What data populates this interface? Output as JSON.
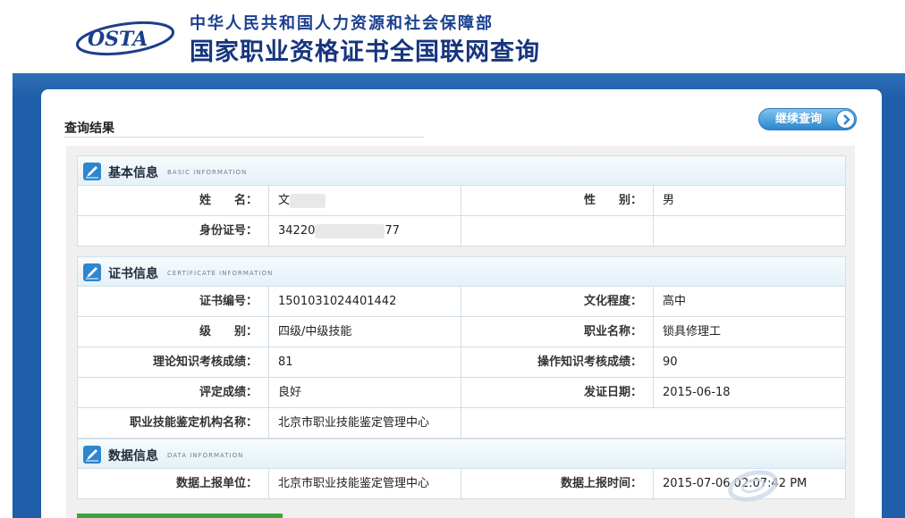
{
  "header": {
    "logo_text": "OSTA",
    "ministry": "中华人民共和国人力资源和社会保障部",
    "site_title": "国家职业资格证书全国联网查询"
  },
  "results": {
    "title": "查询结果",
    "continue_button": "继续查询"
  },
  "basic": {
    "title": "基本信息",
    "subtitle": "BASIC INFORMATION",
    "name_label": "姓　　名：",
    "name_value": "文",
    "gender_label": "性　　别：",
    "gender_value": "男",
    "id_label": "身份证号：",
    "id_prefix": "34220",
    "id_suffix": "77"
  },
  "certificate": {
    "title": "证书信息",
    "subtitle": "CERTIFICATE INFORMATION",
    "number_label": "证书编号：",
    "number_value": "1501031024401442",
    "education_label": "文化程度：",
    "education_value": "高中",
    "level_label": "级　　别：",
    "level_value": "四级/中级技能",
    "occupation_label": "职业名称：",
    "occupation_value": "锁具修理工",
    "theory_label": "理论知识考核成绩：",
    "theory_value": "81",
    "operation_label": "操作知识考核成绩：",
    "operation_value": "90",
    "rating_label": "评定成绩：",
    "rating_value": "良好",
    "issue_date_label": "发证日期：",
    "issue_date_value": "2015-06-18",
    "agency_label": "职业技能鉴定机构名称：",
    "agency_value": "北京市职业技能鉴定管理中心"
  },
  "data_info": {
    "title": "数据信息",
    "subtitle": "DATA INFORMATION",
    "reporter_label": "数据上报单位：",
    "reporter_value": "北京市职业技能鉴定管理中心",
    "report_time_label": "数据上报时间：",
    "report_time_value": "2015-07-06 02:07:42 PM"
  },
  "colors": {
    "band": "#1f5ea8",
    "title_blue": "#17357e",
    "button": "#2b86cf"
  },
  "icons": [
    "osta-logo",
    "pencil-icon",
    "arrow-right-icon",
    "watermark-logo"
  ]
}
